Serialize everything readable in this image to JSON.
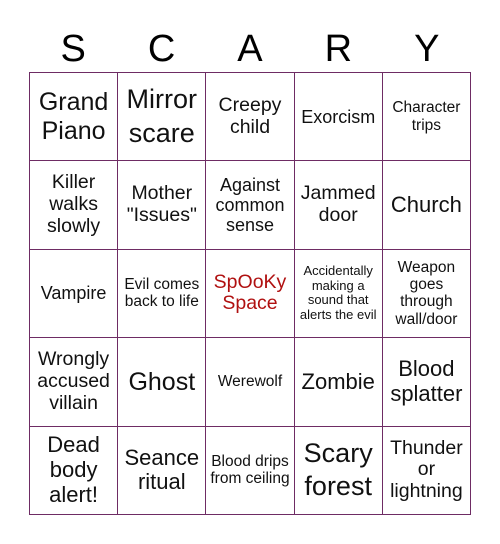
{
  "header": {
    "letters": [
      "S",
      "C",
      "A",
      "R",
      "Y"
    ]
  },
  "free_color": "#b01010",
  "grid_color": "#6e2c64",
  "cells": [
    {
      "text": "Grand Piano",
      "size": "s24"
    },
    {
      "text": "Mirror scare",
      "size": "s27"
    },
    {
      "text": "Creepy child",
      "size": "s19"
    },
    {
      "text": "Exorcism",
      "size": "s17"
    },
    {
      "text": "Character trips",
      "size": "s15"
    },
    {
      "text": "Killer walks slowly",
      "size": "s19"
    },
    {
      "text": "Mother \"Issues\"",
      "size": "s19"
    },
    {
      "text": "Against common sense",
      "size": "s17"
    },
    {
      "text": "Jammed door",
      "size": "s19"
    },
    {
      "text": "Church",
      "size": "s22"
    },
    {
      "text": "Vampire",
      "size": "s17"
    },
    {
      "text": "Evil comes back to life",
      "size": "s15"
    },
    {
      "text": "SpOoKy Space",
      "size": "s19",
      "free": true
    },
    {
      "text": "Accidentally making a sound that alerts the evil",
      "size": "s13"
    },
    {
      "text": "Weapon goes through wall/door",
      "size": "s15"
    },
    {
      "text": "Wrongly accused villain",
      "size": "s19"
    },
    {
      "text": "Ghost",
      "size": "s24"
    },
    {
      "text": "Werewolf",
      "size": "s15"
    },
    {
      "text": "Zombie",
      "size": "s22"
    },
    {
      "text": "Blood splatter",
      "size": "s22"
    },
    {
      "text": "Dead body alert!",
      "size": "s22"
    },
    {
      "text": "Seance ritual",
      "size": "s22"
    },
    {
      "text": "Blood drips from ceiling",
      "size": "s15"
    },
    {
      "text": "Scary forest",
      "size": "s27"
    },
    {
      "text": "Thunder or lightning",
      "size": "s19"
    }
  ]
}
